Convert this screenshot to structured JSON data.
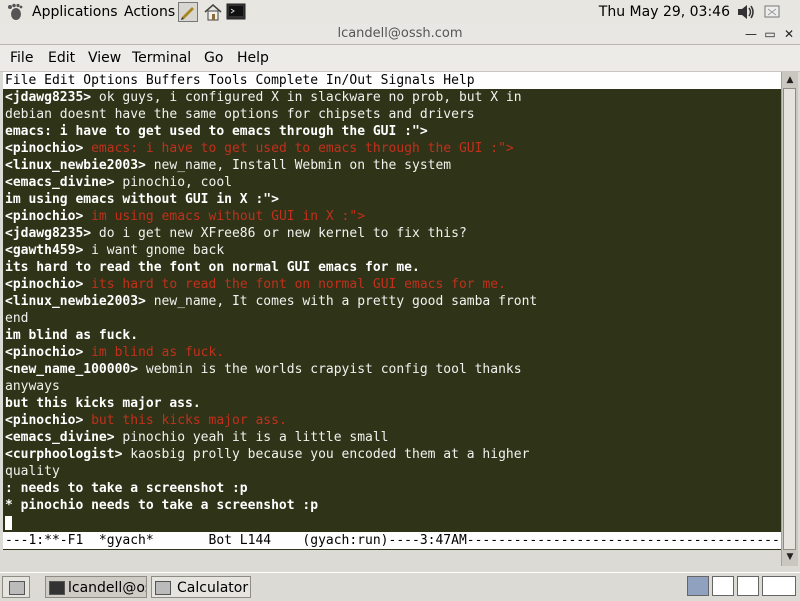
{
  "top_panel": {
    "applications": "Applications",
    "actions": "Actions",
    "clock": "Thu May 29, 03:46"
  },
  "window": {
    "title": "lcandell@ossh.com"
  },
  "menubar": [
    "File",
    "Edit",
    "View",
    "Terminal",
    "Go",
    "Help"
  ],
  "emacs_menubar": "File Edit Options Buffers Tools Complete In/Out Signals Help",
  "chat": [
    {
      "nick": "<jdawg8235>",
      "text": " ok guys, i configured X in slackware no prob, but X in"
    },
    {
      "text": "debian doesnt have the same options for chipsets and drivers"
    },
    {
      "bold": "emacs: i have to get used to emacs through the GUI :\">"
    },
    {
      "nick": "<pinochio>",
      "red": " emacs: i have to get used to emacs through the GUI :\">"
    },
    {
      "nick": "<linux_newbie2003>",
      "text": " new_name, Install Webmin on the system"
    },
    {
      "nick": "<emacs_divine>",
      "text": " pinochio, cool"
    },
    {
      "bold": "im using emacs without GUI in X :\">"
    },
    {
      "nick": "<pinochio>",
      "red": " im using emacs without GUI in X :\">"
    },
    {
      "nick": "<jdawg8235>",
      "text": " do i get new XFree86 or new kernel to fix this?"
    },
    {
      "nick": "<gawth459>",
      "text": " i want gnome back"
    },
    {
      "bold": "its hard to read the font on normal GUI emacs for me."
    },
    {
      "nick": "<pinochio>",
      "red": " its hard to read the font on normal GUI emacs for me."
    },
    {
      "nick": "<linux_newbie2003>",
      "text": " new_name, It comes with a pretty good samba front"
    },
    {
      "text": "end"
    },
    {
      "bold": "im blind as fuck."
    },
    {
      "nick": "<pinochio>",
      "red": " im blind as fuck."
    },
    {
      "nick": "<new_name_100000>",
      "text": " webmin is the worlds crapyist config tool thanks"
    },
    {
      "text": "anyways"
    },
    {
      "bold": "but this kicks major ass."
    },
    {
      "nick": "<pinochio>",
      "red": " but this kicks major ass."
    },
    {
      "nick": "<emacs_divine>",
      "text": " pinochio yeah it is a little small"
    },
    {
      "nick": "<curphoologist>",
      "text": " kaosbig prolly because you encoded them at a higher"
    },
    {
      "text": "quality"
    },
    {
      "bold": ": needs to take a screenshot :p"
    },
    {
      "bold": "* pinochio needs to take a screenshot :p"
    }
  ],
  "modeline": "---1:**-F1  *gyach*       Bot L144    (gyach:run)----3:47AM--------------------------------------------",
  "taskbar": {
    "task1": "lcandell@oss",
    "task2": "Calculator"
  },
  "icons": [
    "gnome-foot-icon",
    "volume-icon",
    "network-icon",
    "terminal-icon",
    "home-icon"
  ],
  "colors": {
    "terminal_bg": "#2f3318",
    "own_text_red": "#c1301c"
  }
}
